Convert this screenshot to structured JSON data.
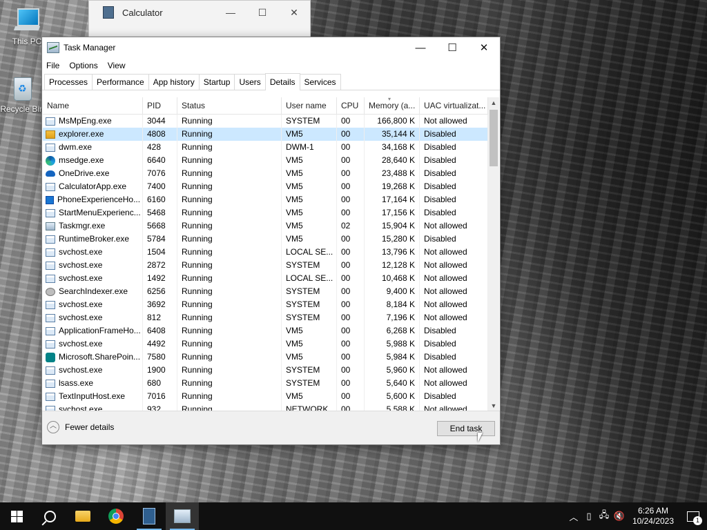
{
  "desktop": {
    "icons": [
      {
        "label": "This PC"
      },
      {
        "label": "Recycle Bin"
      }
    ]
  },
  "calculator": {
    "title": "Calculator"
  },
  "window": {
    "title": "Task Manager",
    "minimize": "—",
    "maximize": "☐",
    "close": "✕"
  },
  "menu": [
    "File",
    "Options",
    "View"
  ],
  "tabs": [
    "Processes",
    "Performance",
    "App history",
    "Startup",
    "Users",
    "Details",
    "Services"
  ],
  "active_tab": "Details",
  "columns": [
    "Name",
    "PID",
    "Status",
    "User name",
    "CPU",
    "Memory (a...",
    "UAC virtualizat..."
  ],
  "rows": [
    {
      "name": "MsMpEng.exe",
      "pid": "3044",
      "status": "Running",
      "user": "SYSTEM",
      "cpu": "00",
      "mem": "166,800 K",
      "uac": "Not allowed",
      "icon": "app"
    },
    {
      "name": "explorer.exe",
      "pid": "4808",
      "status": "Running",
      "user": "VM5",
      "cpu": "00",
      "mem": "35,144 K",
      "uac": "Disabled",
      "icon": "explorer"
    },
    {
      "name": "dwm.exe",
      "pid": "428",
      "status": "Running",
      "user": "DWM-1",
      "cpu": "00",
      "mem": "34,168 K",
      "uac": "Disabled",
      "icon": "app"
    },
    {
      "name": "msedge.exe",
      "pid": "6640",
      "status": "Running",
      "user": "VM5",
      "cpu": "00",
      "mem": "28,640 K",
      "uac": "Disabled",
      "icon": "edge"
    },
    {
      "name": "OneDrive.exe",
      "pid": "7076",
      "status": "Running",
      "user": "VM5",
      "cpu": "00",
      "mem": "23,488 K",
      "uac": "Disabled",
      "icon": "onedrive"
    },
    {
      "name": "CalculatorApp.exe",
      "pid": "7400",
      "status": "Running",
      "user": "VM5",
      "cpu": "00",
      "mem": "19,268 K",
      "uac": "Disabled",
      "icon": "app"
    },
    {
      "name": "PhoneExperienceHo...",
      "pid": "6160",
      "status": "Running",
      "user": "VM5",
      "cpu": "00",
      "mem": "17,164 K",
      "uac": "Disabled",
      "icon": "phone"
    },
    {
      "name": "StartMenuExperienc...",
      "pid": "5468",
      "status": "Running",
      "user": "VM5",
      "cpu": "00",
      "mem": "17,156 K",
      "uac": "Disabled",
      "icon": "app"
    },
    {
      "name": "Taskmgr.exe",
      "pid": "5668",
      "status": "Running",
      "user": "VM5",
      "cpu": "02",
      "mem": "15,904 K",
      "uac": "Not allowed",
      "icon": "taskmgr"
    },
    {
      "name": "RuntimeBroker.exe",
      "pid": "5784",
      "status": "Running",
      "user": "VM5",
      "cpu": "00",
      "mem": "15,280 K",
      "uac": "Disabled",
      "icon": "app"
    },
    {
      "name": "svchost.exe",
      "pid": "1504",
      "status": "Running",
      "user": "LOCAL SE...",
      "cpu": "00",
      "mem": "13,796 K",
      "uac": "Not allowed",
      "icon": "app"
    },
    {
      "name": "svchost.exe",
      "pid": "2872",
      "status": "Running",
      "user": "SYSTEM",
      "cpu": "00",
      "mem": "12,128 K",
      "uac": "Not allowed",
      "icon": "app"
    },
    {
      "name": "svchost.exe",
      "pid": "1492",
      "status": "Running",
      "user": "LOCAL SE...",
      "cpu": "00",
      "mem": "10,468 K",
      "uac": "Not allowed",
      "icon": "app"
    },
    {
      "name": "SearchIndexer.exe",
      "pid": "6256",
      "status": "Running",
      "user": "SYSTEM",
      "cpu": "00",
      "mem": "9,400 K",
      "uac": "Not allowed",
      "icon": "search"
    },
    {
      "name": "svchost.exe",
      "pid": "3692",
      "status": "Running",
      "user": "SYSTEM",
      "cpu": "00",
      "mem": "8,184 K",
      "uac": "Not allowed",
      "icon": "app"
    },
    {
      "name": "svchost.exe",
      "pid": "812",
      "status": "Running",
      "user": "SYSTEM",
      "cpu": "00",
      "mem": "7,196 K",
      "uac": "Not allowed",
      "icon": "app"
    },
    {
      "name": "ApplicationFrameHo...",
      "pid": "6408",
      "status": "Running",
      "user": "VM5",
      "cpu": "00",
      "mem": "6,268 K",
      "uac": "Disabled",
      "icon": "app"
    },
    {
      "name": "svchost.exe",
      "pid": "4492",
      "status": "Running",
      "user": "VM5",
      "cpu": "00",
      "mem": "5,988 K",
      "uac": "Disabled",
      "icon": "app"
    },
    {
      "name": "Microsoft.SharePoin...",
      "pid": "7580",
      "status": "Running",
      "user": "VM5",
      "cpu": "00",
      "mem": "5,984 K",
      "uac": "Disabled",
      "icon": "sharepoint"
    },
    {
      "name": "svchost.exe",
      "pid": "1900",
      "status": "Running",
      "user": "SYSTEM",
      "cpu": "00",
      "mem": "5,960 K",
      "uac": "Not allowed",
      "icon": "app"
    },
    {
      "name": "lsass.exe",
      "pid": "680",
      "status": "Running",
      "user": "SYSTEM",
      "cpu": "00",
      "mem": "5,640 K",
      "uac": "Not allowed",
      "icon": "app"
    },
    {
      "name": "TextInputHost.exe",
      "pid": "7016",
      "status": "Running",
      "user": "VM5",
      "cpu": "00",
      "mem": "5,600 K",
      "uac": "Disabled",
      "icon": "app"
    },
    {
      "name": "svchost.exe",
      "pid": "932",
      "status": "Running",
      "user": "NETWORK ...",
      "cpu": "00",
      "mem": "5,588 K",
      "uac": "Not allowed",
      "icon": "app"
    }
  ],
  "selected_row": 1,
  "footer": {
    "fewer_details": "Fewer details",
    "end_task": "End task"
  },
  "taskbar": {
    "items": [
      "start-icon",
      "search-icon",
      "file-explorer-icon",
      "chrome-icon",
      "calculator-icon",
      "task-manager-icon"
    ],
    "time": "6:26 AM",
    "date": "10/24/2023",
    "notification_count": "1"
  },
  "colors": {
    "selection": "#cce8ff",
    "taskbar": "#101010",
    "accent": "#76b9ed"
  }
}
